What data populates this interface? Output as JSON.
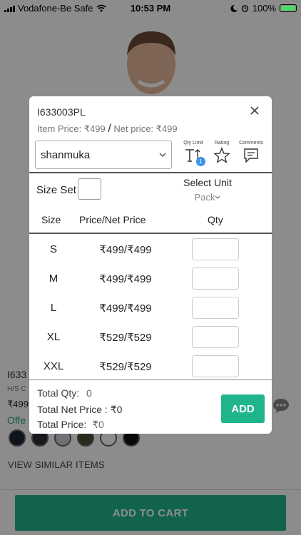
{
  "status_bar": {
    "carrier": "Vodafone-Be Safe",
    "time": "10:53 PM",
    "battery": "100%",
    "battery_level": 1.0
  },
  "background": {
    "sku": "I633",
    "subtitle": "H/S C",
    "price": "₹499",
    "offer": "Offe",
    "swatch_colors": [
      "#1b2433",
      "#2c2f33",
      "#c9d0d8",
      "#4a4f36",
      "#ffffff",
      "#111111"
    ],
    "view_similar": "VIEW SIMILAR ITEMS",
    "add_to_cart": "ADD TO CART"
  },
  "dialog": {
    "sku": "I633003PL",
    "item_price_text": "Item Price: ₹499",
    "separator": "/",
    "net_price_text": "Net price: ₹499",
    "customer_value": "shanmuka",
    "tools": {
      "qty_limit_label": "Qty Limit",
      "qty_limit_badge": "1",
      "rating_label": "Rating",
      "comments_label": "Comments"
    },
    "size_set_label": "Size Set",
    "select_unit_label": "Select Unit",
    "unit_value": "Pack",
    "table_headers": {
      "size": "Size",
      "price": "Price/Net Price",
      "qty": "Qty"
    },
    "rows": [
      {
        "size": "S",
        "price": "₹499/₹499"
      },
      {
        "size": "M",
        "price": "₹499/₹499"
      },
      {
        "size": "L",
        "price": "₹499/₹499"
      },
      {
        "size": "XL",
        "price": "₹529/₹529"
      },
      {
        "size": "XXL",
        "price": "₹529/₹529"
      }
    ],
    "totals": {
      "qty_label": "Total Qty:",
      "qty_value": "0",
      "net_label": "Total Net Price :",
      "net_value": "₹0",
      "price_label": "Total Price:",
      "price_value": "₹0"
    },
    "add_label": "ADD",
    "accent_color": "#20b48c"
  }
}
